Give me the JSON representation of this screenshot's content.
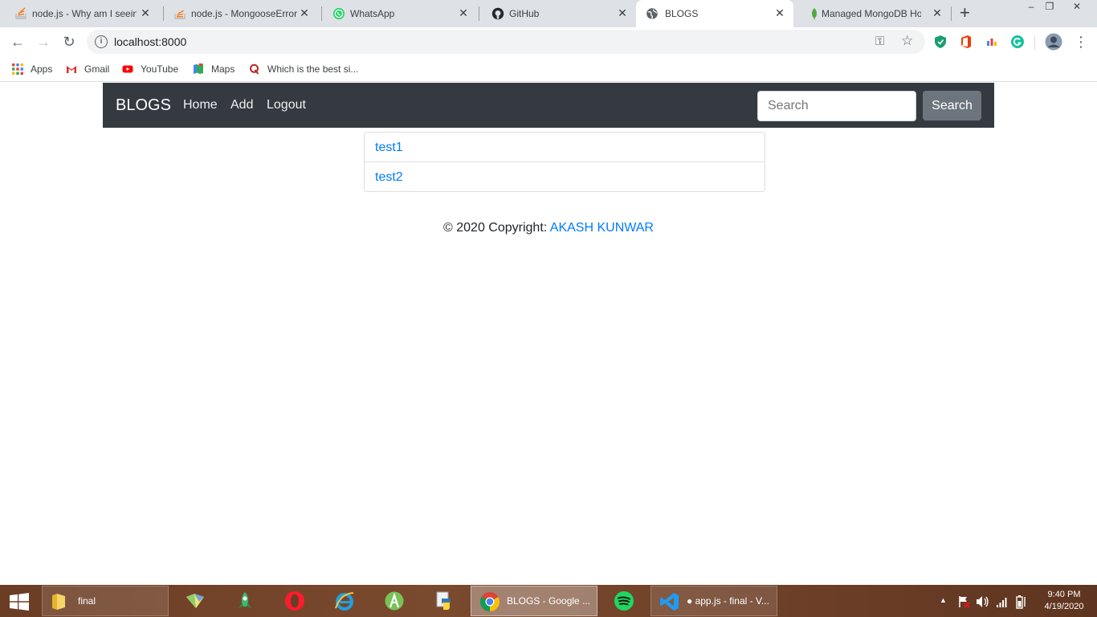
{
  "browser": {
    "tabs": [
      {
        "title": "node.js - Why am I seein",
        "icon": "stackoverflow-icon"
      },
      {
        "title": "node.js - MongooseError",
        "icon": "stackoverflow-icon"
      },
      {
        "title": "WhatsApp",
        "icon": "whatsapp-icon"
      },
      {
        "title": "GitHub",
        "icon": "github-icon"
      },
      {
        "title": "BLOGS",
        "icon": "globe-icon",
        "active": true
      },
      {
        "title": "Managed MongoDB Hos",
        "icon": "mongodb-leaf-icon"
      }
    ],
    "new_tab": "+",
    "close_glyph": "✕",
    "window_controls": {
      "minimize": "–",
      "maximize": "❐",
      "close": "✕"
    },
    "nav": {
      "back": "←",
      "forward": "→",
      "reload": "↻"
    },
    "url": "localhost:8000",
    "omnibox_icons": {
      "key": "⚿",
      "star": "☆"
    },
    "bookmarks": [
      {
        "label": "Apps",
        "icon": "apps-grid-icon"
      },
      {
        "label": "Gmail",
        "icon": "gmail-icon"
      },
      {
        "label": "YouTube",
        "icon": "youtube-icon"
      },
      {
        "label": "Maps",
        "icon": "maps-icon"
      },
      {
        "label": "Which is the best si...",
        "icon": "quora-icon"
      }
    ],
    "menu_glyph": "⋮"
  },
  "page": {
    "navbar": {
      "brand": "BLOGS",
      "links": [
        "Home",
        "Add",
        "Logout"
      ],
      "search_placeholder": "Search",
      "search_button": "Search"
    },
    "posts": [
      "test1",
      "test2"
    ],
    "footer": {
      "text": "© 2020 Copyright: ",
      "author": "AKASH KUNWAR"
    }
  },
  "taskbar": {
    "items": [
      {
        "label": "final",
        "icon": "folder-icon"
      },
      {
        "label": "",
        "icon": "maps-app-icon"
      },
      {
        "label": "",
        "icon": "rocket-icon"
      },
      {
        "label": "",
        "icon": "opera-icon"
      },
      {
        "label": "",
        "icon": "internet-explorer-icon"
      },
      {
        "label": "",
        "icon": "android-studio-icon"
      },
      {
        "label": "",
        "icon": "python-icon"
      },
      {
        "label": "BLOGS - Google ...",
        "icon": "chrome-icon"
      },
      {
        "label": "",
        "icon": "spotify-icon"
      },
      {
        "label": "● app.js - final - V...",
        "icon": "vscode-icon"
      }
    ],
    "tray_chevron": "▲",
    "time": "9:40 PM",
    "date": "4/19/2020"
  },
  "colors": {
    "navbar_bg": "#343a40",
    "link": "#007bff",
    "search_button_bg": "#6c757d",
    "tab_strip_bg": "#dee1e6"
  }
}
